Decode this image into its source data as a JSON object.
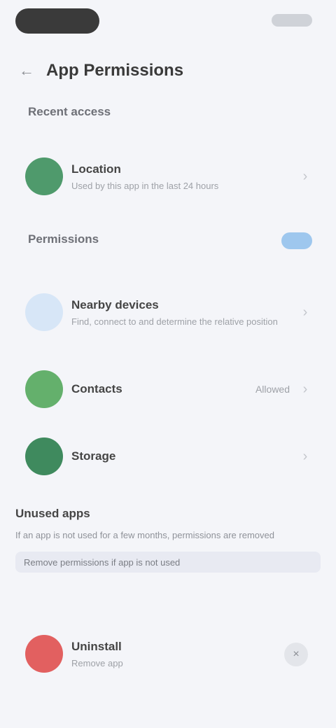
{
  "header": {
    "title": "App Permissions",
    "back_icon": "arrow-left-icon"
  },
  "sections": {
    "recent_label": "Recent access",
    "shared_label": "Permissions"
  },
  "recent": {
    "title": "Location",
    "subtitle": "Used by this app in the last 24 hours",
    "color": "#4f9a6c"
  },
  "items": [
    {
      "title": "Nearby devices",
      "subtitle": "Find, connect to and determine the relative position",
      "color": "#d7e6f7",
      "value": ""
    },
    {
      "title": "Contacts",
      "subtitle": "",
      "color": "#64b06c",
      "value": "Allowed"
    },
    {
      "title": "Storage",
      "subtitle": "",
      "color": "#3f8a5e",
      "value": ""
    }
  ],
  "info": {
    "title": "Unused apps",
    "text": "If an app is not used for a few months, permissions are removed",
    "link": "Remove permissions if app is not used"
  },
  "danger": {
    "title": "Uninstall",
    "subtitle": "Remove app",
    "color": "#e26060"
  }
}
